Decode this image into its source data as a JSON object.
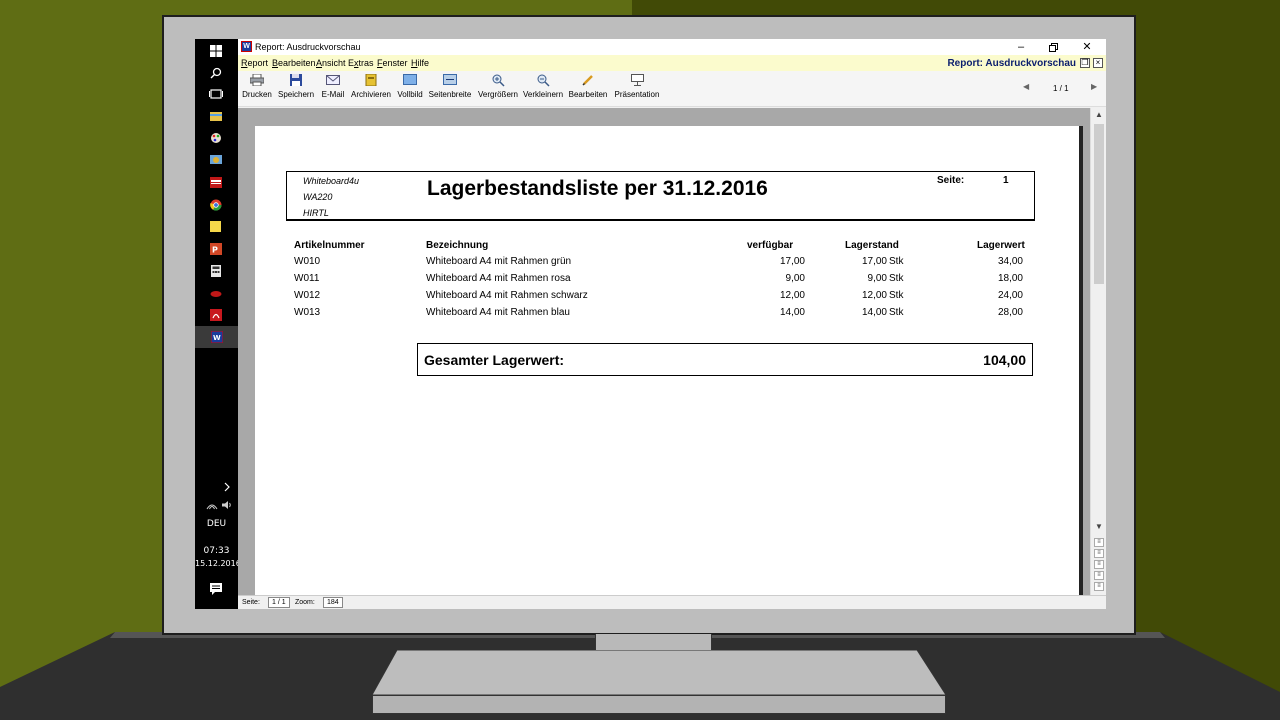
{
  "window": {
    "title": "Report: Ausdruckvorschau",
    "menu_title": "Report: Ausdruckvorschau"
  },
  "menu": [
    {
      "pre": "",
      "u": "R",
      "post": "eport"
    },
    {
      "pre": "",
      "u": "B",
      "post": "earbeiten"
    },
    {
      "pre": "",
      "u": "A",
      "post": "nsicht"
    },
    {
      "pre": "E",
      "u": "x",
      "post": "tras"
    },
    {
      "pre": "",
      "u": "F",
      "post": "enster"
    },
    {
      "pre": "",
      "u": "H",
      "post": "ilfe"
    }
  ],
  "toolbar": {
    "drucken": "Drucken",
    "speichern": "Speichern",
    "email": "E-Mail",
    "archivieren": "Archivieren",
    "vollbild": "Vollbild",
    "seitenbreite": "Seitenbreite",
    "vergroessern": "Vergrößern",
    "verkleinern": "Verkleinern",
    "bearbeiten": "Bearbeiten",
    "praesentation": "Präsentation",
    "page_counter": "1 / 1"
  },
  "taskbar": {
    "language": "DEU",
    "time": "07:33",
    "date": "15.12.2016"
  },
  "report": {
    "company": "Whiteboard4u",
    "line2": "WA220",
    "line3": "HIRTL",
    "title": "Lagerbestandsliste per 31.12.2016",
    "seite_label": "Seite:",
    "seite_value": "1",
    "columns": {
      "artikelnummer": "Artikelnummer",
      "bezeichnung": "Bezeichnung",
      "verfuegbar": "verfügbar",
      "lagerstand": "Lagerstand",
      "lagerwert": "Lagerwert"
    },
    "rows": [
      {
        "nr": "W010",
        "bez": "Whiteboard A4 mit Rahmen grün",
        "verf": "17,00",
        "stand": "17,00",
        "unit": "Stk",
        "wert": "34,00"
      },
      {
        "nr": "W011",
        "bez": "Whiteboard A4 mit Rahmen rosa",
        "verf": "9,00",
        "stand": "9,00",
        "unit": "Stk",
        "wert": "18,00"
      },
      {
        "nr": "W012",
        "bez": "Whiteboard A4 mit Rahmen schwarz",
        "verf": "12,00",
        "stand": "12,00",
        "unit": "Stk",
        "wert": "24,00"
      },
      {
        "nr": "W013",
        "bez": "Whiteboard A4 mit Rahmen blau",
        "verf": "14,00",
        "stand": "14,00",
        "unit": "Stk",
        "wert": "28,00"
      }
    ],
    "total_label": "Gesamter Lagerwert:",
    "total_value": "104,00"
  },
  "status": {
    "seite_label": "Seite:",
    "seite_value": "1 / 1",
    "zoom_label": "Zoom:",
    "zoom_value": "184"
  },
  "colors": {
    "menu_bg": "#fbfbcd",
    "title_accent": "#0b1e6e",
    "taskbar": "#000000",
    "wall_left": "#5f6d14",
    "wall_right": "#414a06"
  }
}
